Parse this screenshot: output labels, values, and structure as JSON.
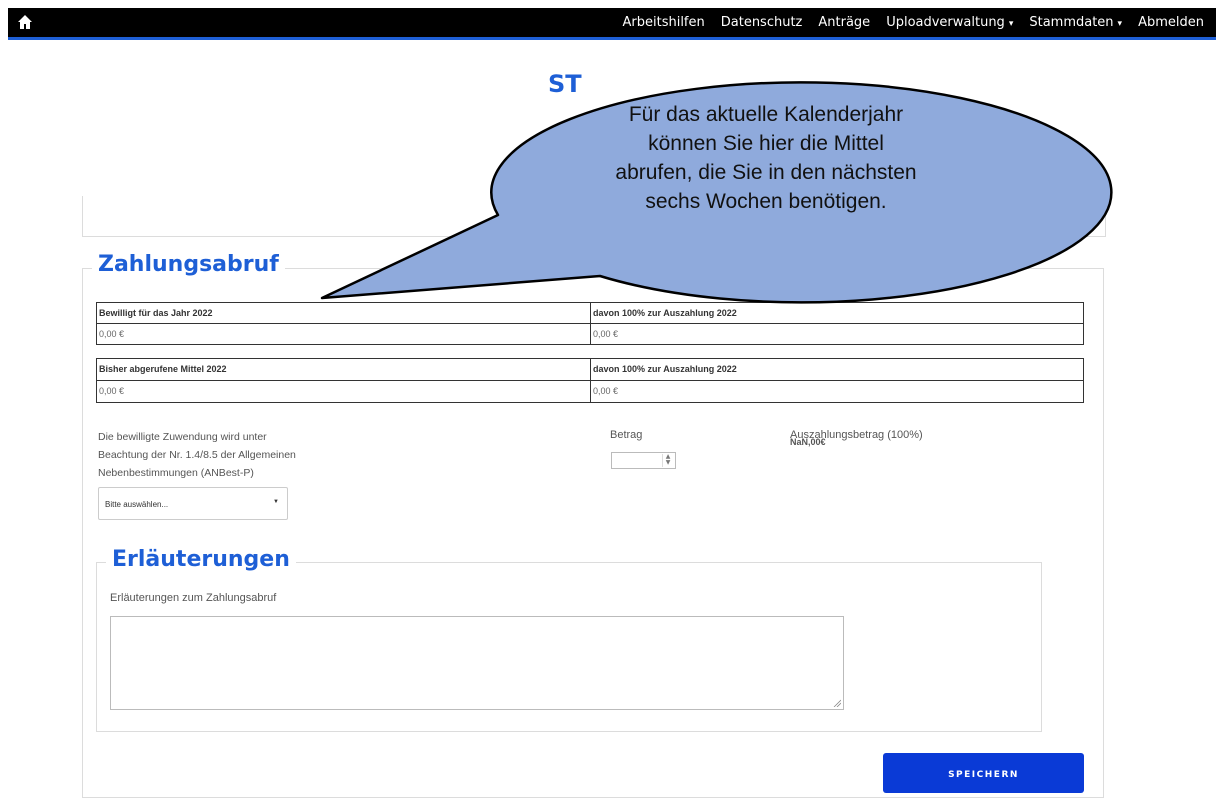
{
  "nav": {
    "home_icon": "home-icon",
    "items": [
      {
        "label": "Arbeitshilfen",
        "dropdown": false
      },
      {
        "label": "Datenschutz",
        "dropdown": false
      },
      {
        "label": "Anträge",
        "dropdown": false
      },
      {
        "label": "Uploadverwaltung",
        "dropdown": true
      },
      {
        "label": "Stammdaten",
        "dropdown": true
      },
      {
        "label": "Abmelden",
        "dropdown": false
      }
    ],
    "caret": "▾"
  },
  "page_title_peek": "ST",
  "callout": {
    "lines": [
      "Für das aktuelle Kalenderjahr",
      "können Sie hier die Mittel",
      "abrufen, die Sie in den nächsten",
      "sechs Wochen benötigen."
    ]
  },
  "zahlungsabruf": {
    "legend": "Zahlungsabruf",
    "table1": {
      "headers": [
        "Bewilligt für das Jahr 2022",
        "davon 100% zur Auszahlung 2022"
      ],
      "values": [
        "0,00 €",
        "0,00 €"
      ]
    },
    "table2": {
      "headers": [
        "Bisher abgerufene Mittel 2022",
        "davon 100% zur Auszahlung 2022"
      ],
      "values": [
        "0,00 €",
        "0,00 €"
      ]
    },
    "info_text": "Die bewilligte Zuwendung wird unter Beachtung der Nr. 1.4/8.5 der Allgemeinen Nebenbestimmungen (ANBest-P)",
    "select_value": "Bitte auswählen...",
    "betrag_label": "Betrag",
    "betrag_value": "",
    "auszahlung_label": "Auszahlungsbetrag (100%)",
    "auszahlung_value": "NaN,00€"
  },
  "erlaeuterungen": {
    "legend": "Erläuterungen",
    "field_label": "Erläuterungen zum Zahlungsabruf",
    "field_value": ""
  },
  "save_button": "SPEICHERN",
  "colors": {
    "accent": "#1e5fd6",
    "button": "#0a3ad6",
    "bubble_fill": "#8faadc",
    "bubble_stroke": "#000000"
  }
}
